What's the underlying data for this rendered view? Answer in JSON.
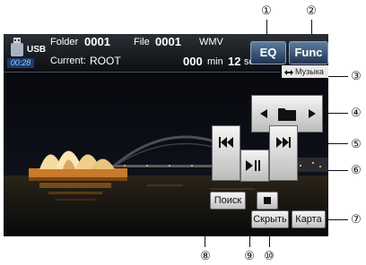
{
  "callouts": [
    "①",
    "②",
    "③",
    "④",
    "⑤",
    "⑥",
    "⑦",
    "⑧",
    "⑨",
    "⑩"
  ],
  "info": {
    "usb": "USB",
    "elapsed": "00:28",
    "folder_label": "Folder",
    "folder_number": "0001",
    "file_label": "File",
    "file_number": "0001",
    "format": "WMV",
    "current_label": "Current:",
    "current_folder": "ROOT",
    "time_min_value": "000",
    "time_min_unit": "min",
    "time_sec_value": "12",
    "time_sec_unit": "sec"
  },
  "buttons": {
    "eq": "EQ",
    "func": "Func",
    "music_switch": "Музыка",
    "search": "Поиск",
    "hide": "Скрыть",
    "map": "Карта"
  },
  "icons": [
    "usb-drive-icon",
    "folder-icon",
    "arrow-left-icon",
    "arrow-right-icon",
    "previous-track-icon",
    "next-track-icon",
    "play-pause-icon",
    "stop-icon",
    "swap-arrows-icon"
  ]
}
